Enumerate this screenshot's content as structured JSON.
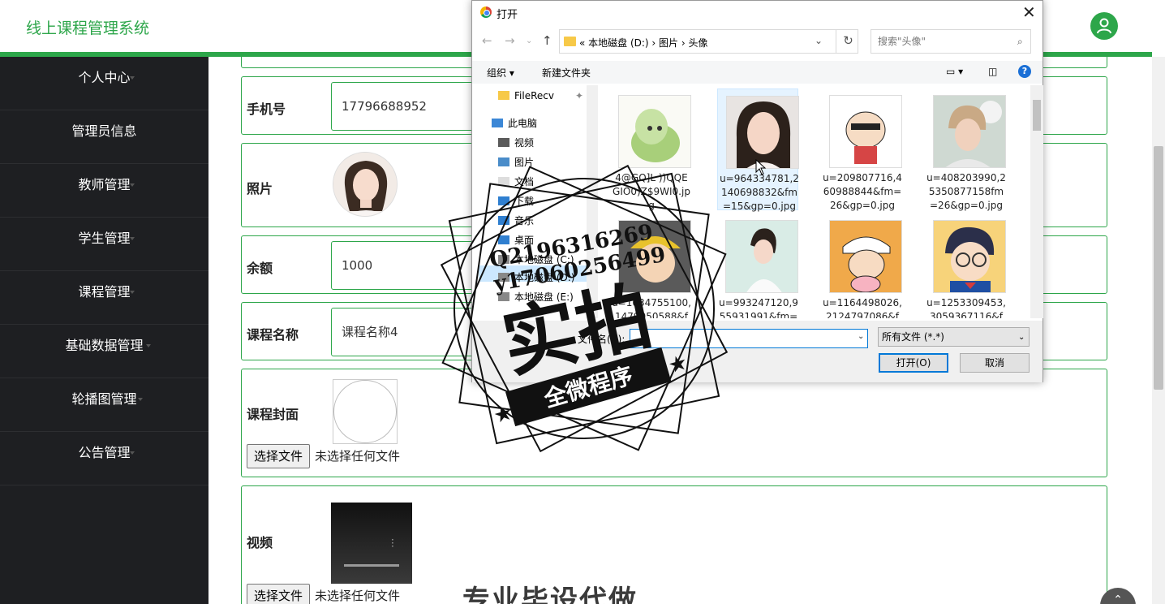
{
  "header": {
    "brand": "线上课程管理系统"
  },
  "sidebar": {
    "items": [
      {
        "label": "个人中心"
      },
      {
        "label": "管理员信息"
      },
      {
        "label": "教师管理"
      },
      {
        "label": "学生管理"
      },
      {
        "label": "课程管理"
      },
      {
        "label": "基础数据管理"
      },
      {
        "label": "轮播图管理"
      },
      {
        "label": "公告管理"
      }
    ]
  },
  "form": {
    "phone": {
      "label": "手机号",
      "value": "17796688952"
    },
    "photo": {
      "label": "照片"
    },
    "balance": {
      "label": "余额",
      "value": "1000"
    },
    "course_name": {
      "label": "课程名称",
      "value": "课程名称4"
    },
    "cover": {
      "label": "课程封面",
      "button": "选择文件",
      "status": "未选择任何文件"
    },
    "video": {
      "label": "视频",
      "button": "选择文件",
      "status": "未选择任何文件"
    }
  },
  "dialog": {
    "title": "打开",
    "breadcrumb": "«  本地磁盘 (D:)  ›  图片  ›  头像",
    "search_placeholder": "搜索\"头像\"",
    "organize": "组织 ▾",
    "new_folder": "新建文件夹",
    "tree": [
      {
        "label": "FileRecv"
      },
      {
        "label": "此电脑"
      },
      {
        "label": "视频"
      },
      {
        "label": "图片"
      },
      {
        "label": "文档"
      },
      {
        "label": "下载"
      },
      {
        "label": "音乐"
      },
      {
        "label": "桌面"
      },
      {
        "label": "本地磁盘 (C:)"
      },
      {
        "label": "本地磁盘 (D:)"
      },
      {
        "label": "本地磁盘 (E:)"
      }
    ],
    "files": [
      {
        "name": "4@GQ]L ))QQEGIO0)Z$9WI0.jpg"
      },
      {
        "name": "u=964334781,2140698832&fm=15&gp=0.jpg"
      },
      {
        "name": "u=209807716,460988844&fm=26&gp=0.jpg"
      },
      {
        "name": "u=408203990,25350877158fm=26&gp=0.jpg"
      },
      {
        "name": "u=1034755100,1479950588&fm"
      },
      {
        "name": "u=993247120,955931991&fm="
      },
      {
        "name": "u=1164498026,2124797086&f"
      },
      {
        "name": "u=1253309453,3059367116&f"
      }
    ],
    "filename_label": "文件名(N):",
    "file_type": "所有文件 (*.*)",
    "open_button": "打开(O)",
    "cancel_button": "取消"
  },
  "watermark": {
    "qq": "Q2196316269",
    "wx": "y17060256499",
    "big": "实拍",
    "banner": "全微程序",
    "bottom": "专业毕设代做"
  },
  "colors": {
    "accent": "#2da64a",
    "sidebar_bg": "#1e1f22"
  }
}
